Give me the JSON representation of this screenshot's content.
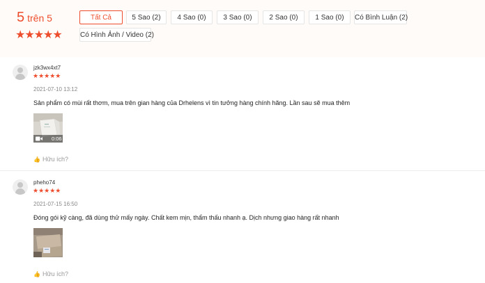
{
  "rating_summary": {
    "score": "5",
    "out_of": "trên 5",
    "stars": "★★★★★"
  },
  "filters": [
    {
      "label": "Tất Cả"
    },
    {
      "label": "5 Sao (2)"
    },
    {
      "label": "4 Sao (0)"
    },
    {
      "label": "3 Sao (0)"
    },
    {
      "label": "2 Sao (0)"
    },
    {
      "label": "1 Sao (0)"
    },
    {
      "label": "Có Bình Luận (2)"
    },
    {
      "label": "Có Hình Ảnh / Video (2)"
    }
  ],
  "reviews": [
    {
      "username": "jzk3wx4xt7",
      "stars": "★★★★★",
      "timestamp": "2021-07-10 13:12",
      "text": "Sản phẩm có mùi rất thơm, mua trên gian hàng của Drhelens vì tin tưởng hàng chính hãng. Lần sau sẽ mua thêm",
      "video_duration": "0:06",
      "helpful_label": "Hữu ích?"
    },
    {
      "username": "pheho74",
      "stars": "★★★★★",
      "timestamp": "2021-07-15 16:50",
      "text": "Đóng gói kỹ càng, đã dùng thử mấy ngày. Chất kem mịn, thẩm thấu nhanh ạ. Dịch nhưng giao hàng rất nhanh",
      "helpful_label": "Hữu ích?"
    }
  ],
  "colors": {
    "accent": "#ee4d2d",
    "summary_background": "#fffbf8"
  }
}
